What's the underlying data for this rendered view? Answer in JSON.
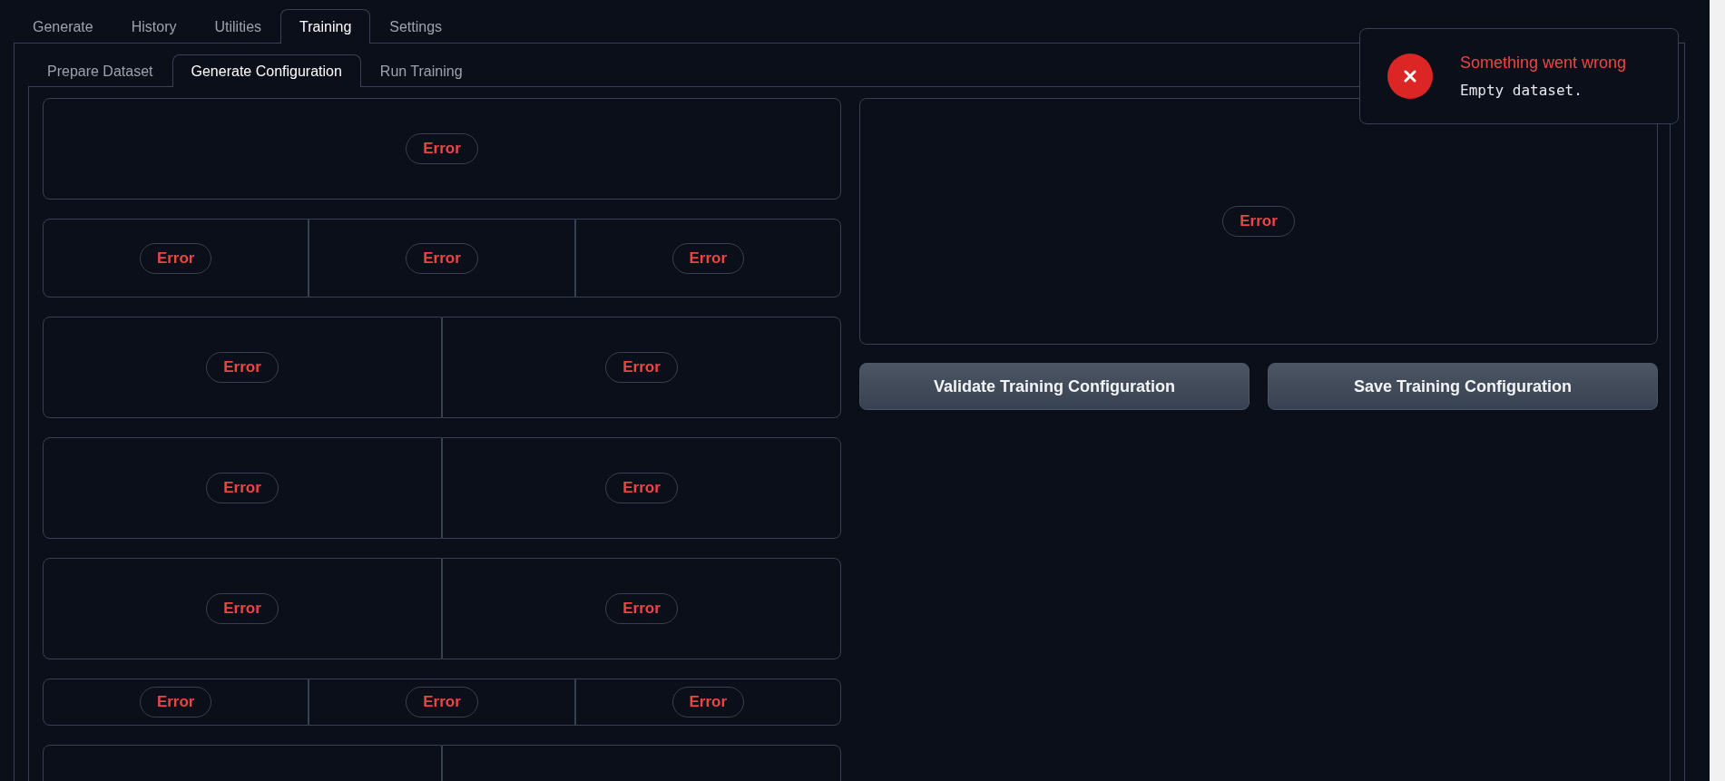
{
  "tabs": [
    {
      "label": "Generate",
      "selected": false
    },
    {
      "label": "History",
      "selected": false
    },
    {
      "label": "Utilities",
      "selected": false
    },
    {
      "label": "Training",
      "selected": true
    },
    {
      "label": "Settings",
      "selected": false
    }
  ],
  "subtabs": [
    {
      "label": "Prepare Dataset",
      "selected": false
    },
    {
      "label": "Generate Configuration",
      "selected": true
    },
    {
      "label": "Run Training",
      "selected": false
    }
  ],
  "form_rows": [
    {
      "kind": "tall",
      "cells": [
        {
          "kind": "error",
          "label": "Error"
        }
      ]
    },
    {
      "kind": "medium",
      "cells": [
        {
          "kind": "error",
          "label": "Error"
        },
        {
          "kind": "error",
          "label": "Error"
        },
        {
          "kind": "error",
          "label": "Error"
        }
      ]
    },
    {
      "kind": "tall",
      "cells": [
        {
          "kind": "error",
          "label": "Error"
        },
        {
          "kind": "error",
          "label": "Error"
        }
      ]
    },
    {
      "kind": "tall",
      "cells": [
        {
          "kind": "error",
          "label": "Error"
        },
        {
          "kind": "error",
          "label": "Error"
        }
      ]
    },
    {
      "kind": "tall",
      "cells": [
        {
          "kind": "error",
          "label": "Error"
        },
        {
          "kind": "error",
          "label": "Error"
        }
      ]
    },
    {
      "kind": "short",
      "cells": [
        {
          "kind": "error",
          "label": "Error"
        },
        {
          "kind": "error",
          "label": "Error"
        },
        {
          "kind": "error",
          "label": "Error"
        }
      ]
    },
    {
      "kind": "tall",
      "cells": [
        {
          "kind": "blank"
        },
        {
          "kind": "blank"
        }
      ]
    }
  ],
  "preview": {
    "label": "Error"
  },
  "buttons": [
    "Validate Training Configuration",
    "Save Training Configuration"
  ],
  "toast": {
    "title": "Something went wrong",
    "message": "Empty dataset."
  }
}
